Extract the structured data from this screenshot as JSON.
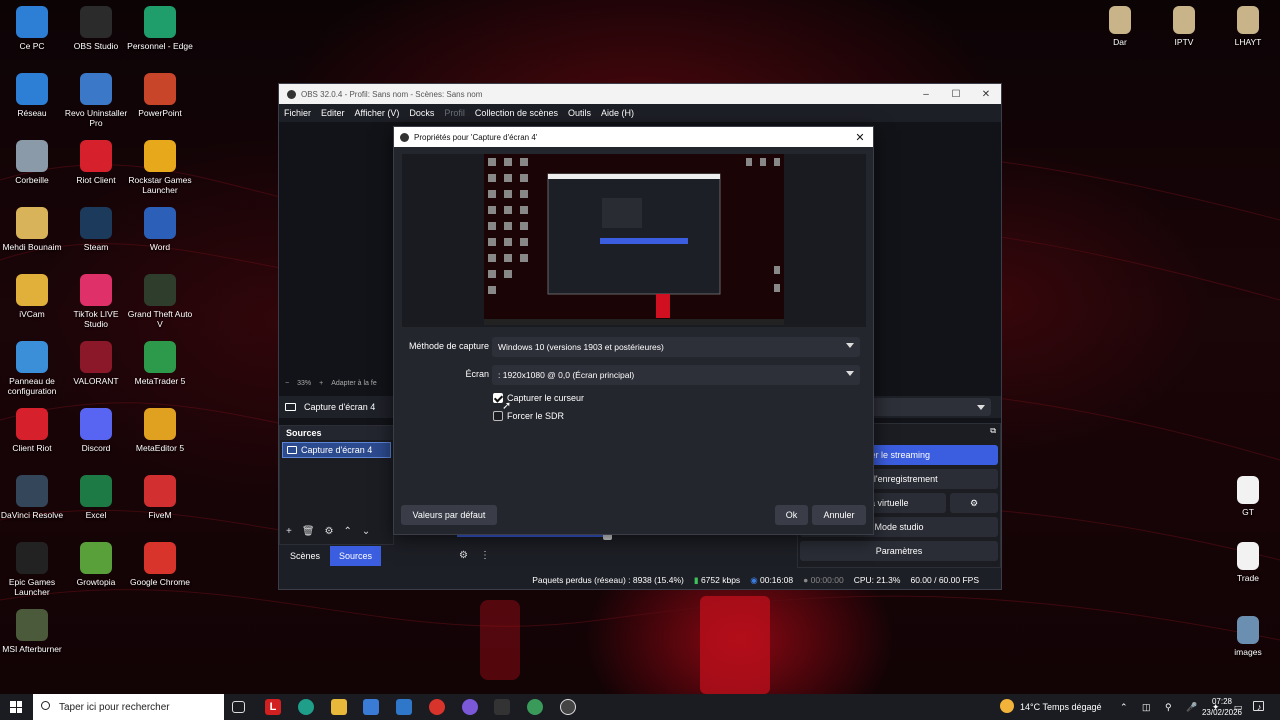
{
  "desktop_icons": [
    {
      "label": "Ce PC",
      "icon": "computer-icon",
      "color": "#2d7fd6"
    },
    {
      "label": "OBS Studio",
      "icon": "obs-icon",
      "color": "#2b2b2b"
    },
    {
      "label": "Personnel - Edge",
      "icon": "edge-icon",
      "color": "#1f9e6b"
    },
    {
      "label": "Réseau",
      "icon": "network-icon",
      "color": "#2d7fd6"
    },
    {
      "label": "Revo Uninstaller Pro",
      "icon": "revo-icon",
      "color": "#3c78c8"
    },
    {
      "label": "PowerPoint",
      "icon": "powerpoint-icon",
      "color": "#c9452a"
    },
    {
      "label": "Corbeille",
      "icon": "recycle-bin-icon",
      "color": "#8a9aa8"
    },
    {
      "label": "Riot Client",
      "icon": "riot-icon",
      "color": "#d6202c"
    },
    {
      "label": "Rockstar Games Launcher",
      "icon": "rockstar-icon",
      "color": "#e7a91b"
    },
    {
      "label": "Mehdi Bounaim",
      "icon": "user-folder-icon",
      "color": "#d9b35a"
    },
    {
      "label": "Steam",
      "icon": "steam-icon",
      "color": "#1b3a5c"
    },
    {
      "label": "Word",
      "icon": "word-icon",
      "color": "#2b5fb8"
    },
    {
      "label": "iVCam",
      "icon": "ivcam-icon",
      "color": "#e0b03a"
    },
    {
      "label": "TikTok LIVE Studio",
      "icon": "tiktok-icon",
      "color": "#e0306a"
    },
    {
      "label": "Grand Theft Auto V",
      "icon": "gta-icon",
      "color": "#2f3d2c"
    },
    {
      "label": "Panneau de configuration",
      "icon": "control-panel-icon",
      "color": "#3a8fd8"
    },
    {
      "label": "VALORANT",
      "icon": "valorant-icon",
      "color": "#8a1828"
    },
    {
      "label": "MetaTrader 5",
      "icon": "metatrader-icon",
      "color": "#2c9a4a"
    },
    {
      "label": "Client Riot",
      "icon": "riot-client-icon",
      "color": "#d6202c"
    },
    {
      "label": "Discord",
      "icon": "discord-icon",
      "color": "#5865f2"
    },
    {
      "label": "MetaEditor 5",
      "icon": "metaeditor-icon",
      "color": "#e0a020"
    },
    {
      "label": "DaVinci Resolve",
      "icon": "davinci-icon",
      "color": "#34465a"
    },
    {
      "label": "Excel",
      "icon": "excel-icon",
      "color": "#1e7a44"
    },
    {
      "label": "FiveM",
      "icon": "fivem-icon",
      "color": "#d23030"
    },
    {
      "label": "Epic Games Launcher",
      "icon": "epic-icon",
      "color": "#222222"
    },
    {
      "label": "Growtopia",
      "icon": "growtopia-icon",
      "color": "#5aa03a"
    },
    {
      "label": "Google Chrome",
      "icon": "chrome-icon",
      "color": "#d9342b"
    },
    {
      "label": "MSI Afterburner",
      "icon": "msi-icon",
      "color": "#4a5a3a"
    }
  ],
  "right_icons": [
    {
      "label": "Dar",
      "icon": "folder-icon"
    },
    {
      "label": "IPTV",
      "icon": "folder-icon"
    },
    {
      "label": "LHAYT",
      "icon": "folder-icon"
    },
    {
      "label": "GT",
      "icon": "file-icon"
    },
    {
      "label": "Trade",
      "icon": "file-icon"
    },
    {
      "label": "images",
      "icon": "image-folder-icon"
    }
  ],
  "obs": {
    "title": "OBS 32.0.4 - Profil: Sans nom - Scènes: Sans nom",
    "menu": [
      "Fichier",
      "Editer",
      "Afficher (V)",
      "Docks",
      "Profil",
      "Collection de scènes",
      "Outils",
      "Aide (H)"
    ],
    "zoom": "33%",
    "zoom_fit": "Adapter à la fe",
    "source_name": "Capture d'écran 4",
    "sources_title": "Sources",
    "source_item": "Capture d'écran 4",
    "tabs": [
      "Scènes",
      "Sources"
    ],
    "controls": [
      "ter le streaming",
      "rer l'enregistrement",
      "a caméra virtuelle",
      "Mode studio",
      "Paramètres"
    ],
    "status": {
      "dropped": "Paquets perdus (réseau) : 8938 (15.4%)",
      "bitrate": "6752 kbps",
      "stream_time": "00:16:08",
      "rec_time": "00:00:00",
      "cpu": "CPU: 21.3%",
      "fps": "60.00 / 60.00 FPS"
    }
  },
  "dialog": {
    "title": "Propriétés pour 'Capture d'écran 4'",
    "method_label": "Méthode de capture",
    "method_value": "Windows 10 (versions 1903 et postérieures)",
    "screen_label": "Écran",
    "screen_value": ": 1920x1080 @ 0,0 (Écran principal)",
    "capture_cursor": "Capturer le curseur",
    "capture_cursor_checked": true,
    "force_sdr": "Forcer le SDR",
    "force_sdr_checked": false,
    "defaults_button": "Valeurs par défaut",
    "ok_button": "Ok",
    "cancel_button": "Annuler"
  },
  "taskbar": {
    "search_placeholder": "Taper ici pour rechercher",
    "weather": "14°C  Temps dégagé",
    "time": "07:28",
    "date": "23/02/2026"
  }
}
